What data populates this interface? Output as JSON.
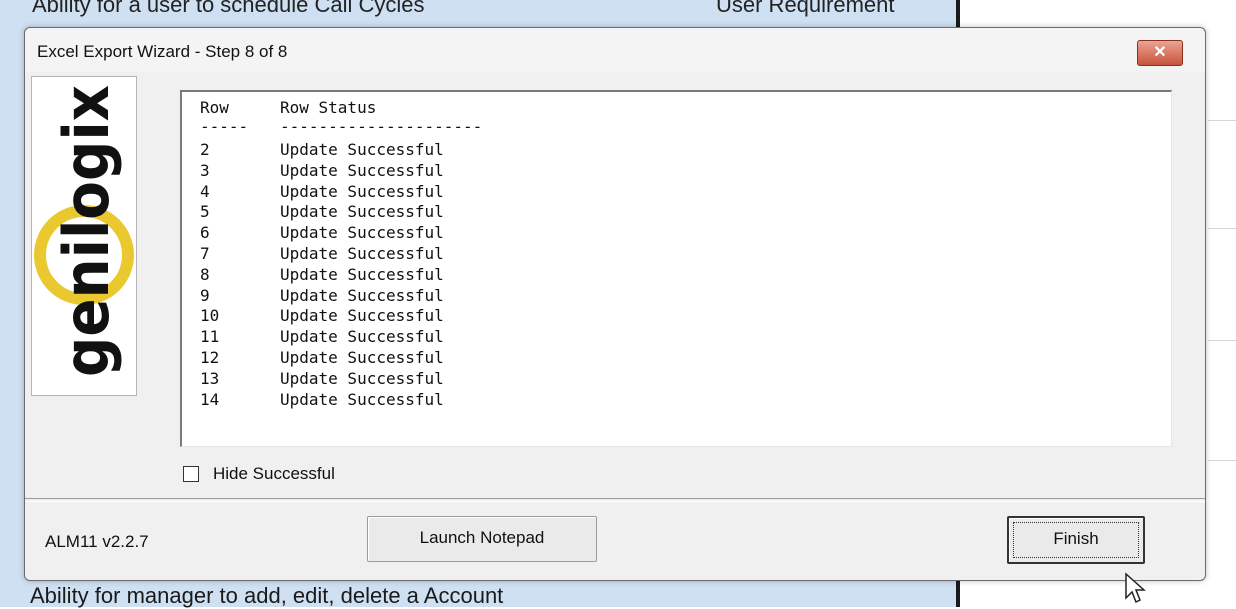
{
  "background": {
    "top_cells": [
      "Ability for a user to schedule Call Cycles",
      "User Requirement"
    ],
    "bottom_cell": "Ability for manager to add, edit, delete a Account"
  },
  "dialog": {
    "title": "Excel Export Wizard - Step 8 of 8",
    "close_label": "✕",
    "logo_text": "genilogix",
    "output": {
      "header_row": "Row",
      "header_status": "Row Status",
      "dash_row": "-----",
      "dash_status": "---------------------",
      "rows": [
        {
          "row": "2",
          "status": "Update Successful"
        },
        {
          "row": "3",
          "status": "Update Successful"
        },
        {
          "row": "4",
          "status": "Update Successful"
        },
        {
          "row": "5",
          "status": "Update Successful"
        },
        {
          "row": "6",
          "status": "Update Successful"
        },
        {
          "row": "7",
          "status": "Update Successful"
        },
        {
          "row": "8",
          "status": "Update Successful"
        },
        {
          "row": "9",
          "status": "Update Successful"
        },
        {
          "row": "10",
          "status": "Update Successful"
        },
        {
          "row": "11",
          "status": "Update Successful"
        },
        {
          "row": "12",
          "status": "Update Successful"
        },
        {
          "row": "13",
          "status": "Update Successful"
        },
        {
          "row": "14",
          "status": "Update Successful"
        }
      ]
    },
    "hide_successful": {
      "label": "Hide Successful",
      "checked": false
    },
    "version": "ALM11 v2.2.7",
    "launch_notepad_label": "Launch Notepad",
    "finish_label": "Finish"
  },
  "colors": {
    "close_button": "#c8523a",
    "logo_ring": "#e8c21a",
    "sheet_background": "#cfe0f2"
  }
}
